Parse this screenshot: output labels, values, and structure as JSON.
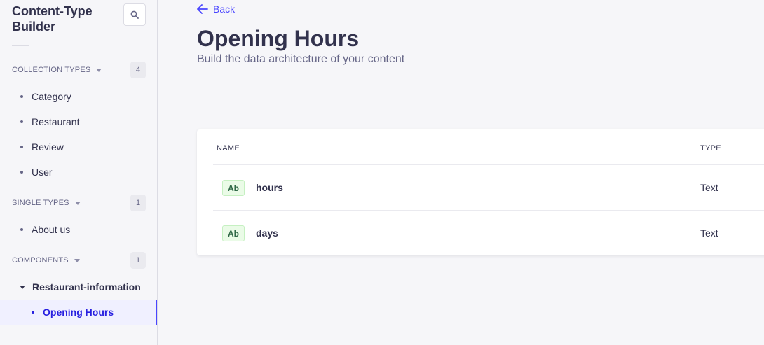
{
  "sidebar": {
    "title": "Content-Type Builder",
    "sections": [
      {
        "label": "COLLECTION TYPES",
        "count": "4",
        "items": [
          "Category",
          "Restaurant",
          "Review",
          "User"
        ]
      },
      {
        "label": "SINGLE TYPES",
        "count": "1",
        "items": [
          "About us"
        ]
      },
      {
        "label": "COMPONENTS",
        "count": "1",
        "group": "Restaurant-information",
        "items": [
          "Opening Hours"
        ]
      }
    ]
  },
  "header": {
    "back_label": "Back",
    "title": "Opening Hours",
    "subtitle": "Build the data architecture of your content"
  },
  "table": {
    "columns": [
      "NAME",
      "TYPE"
    ],
    "rows": [
      {
        "badge": "Ab",
        "name": "hours",
        "type": "Text"
      },
      {
        "badge": "Ab",
        "name": "days",
        "type": "Text"
      }
    ]
  },
  "colors": {
    "accent": "#4945ff",
    "active_bg": "#f0f0ff",
    "badge_bg": "#eafbe7"
  },
  "icons": {
    "search": "search-icon",
    "back": "arrow-left-icon",
    "caret": "caret-down-icon"
  }
}
